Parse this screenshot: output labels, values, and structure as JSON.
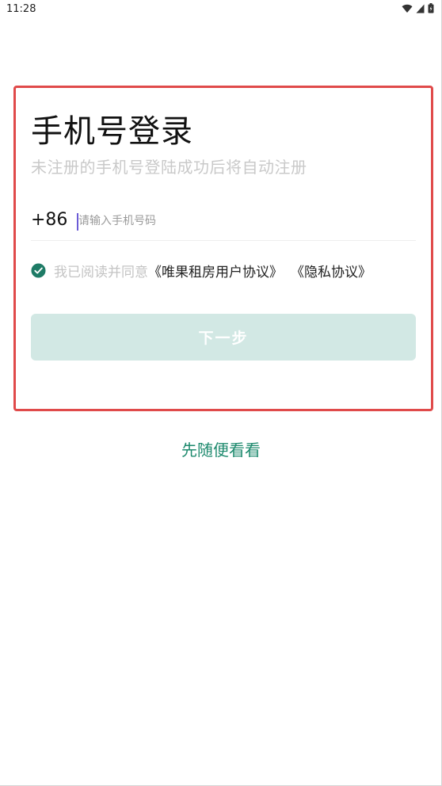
{
  "status_bar": {
    "time": "11:28",
    "icons": [
      "wifi-icon",
      "signal-icon",
      "battery-icon"
    ]
  },
  "login": {
    "title": "手机号登录",
    "subtitle": "未注册的手机号登陆成功后将自动注册",
    "country_code": "+86",
    "phone_placeholder": "请输入手机号码",
    "phone_value": "",
    "agreement": {
      "checked": true,
      "prefix": "我已阅读并同意",
      "user_agreement": "《唯果租房用户协议》",
      "privacy_agreement": "《隐私协议》"
    },
    "next_label": "下一步"
  },
  "browse_label": "先随便看看",
  "colors": {
    "highlight_border": "#e04a4a",
    "accent_green": "#1e8a6e",
    "button_disabled": "#d2e8e4",
    "check": "#1e7b66",
    "placeholder": "#c9c9c9"
  }
}
